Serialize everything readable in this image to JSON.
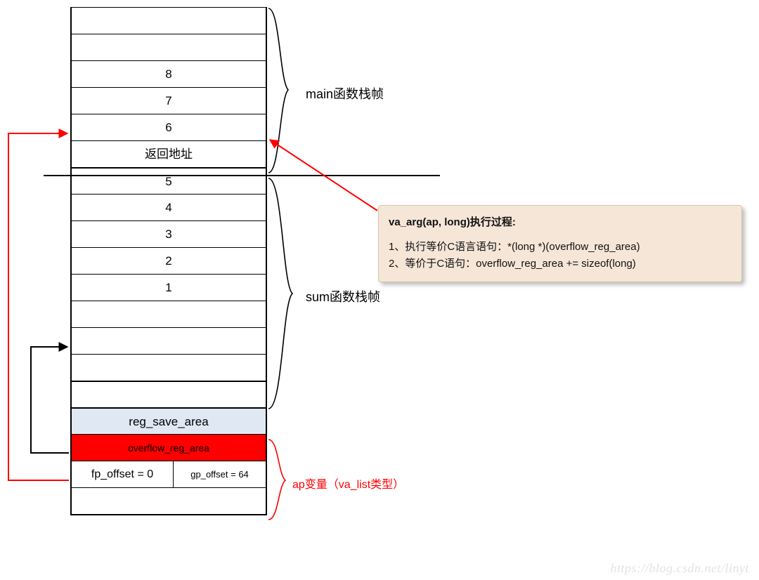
{
  "stack_cells": [
    {
      "kind": "blank",
      "text": ""
    },
    {
      "kind": "blank",
      "text": ""
    },
    {
      "kind": "value",
      "text": "8"
    },
    {
      "kind": "value",
      "text": "7"
    },
    {
      "kind": "value",
      "text": "6"
    },
    {
      "kind": "return_addr",
      "text": "返回地址"
    },
    {
      "kind": "value",
      "text": "5"
    },
    {
      "kind": "value",
      "text": "4"
    },
    {
      "kind": "value",
      "text": "3"
    },
    {
      "kind": "value",
      "text": "2"
    },
    {
      "kind": "value",
      "text": "1"
    },
    {
      "kind": "blank",
      "text": ""
    },
    {
      "kind": "blank",
      "text": ""
    },
    {
      "kind": "blank",
      "text": ""
    },
    {
      "kind": "blank",
      "text": ""
    },
    {
      "kind": "reg_save_area",
      "text": "reg_save_area"
    },
    {
      "kind": "overflow_reg_area",
      "text": "overflow_reg_area"
    },
    {
      "kind": "offsets",
      "fp": "fp_offset = 0",
      "gp": "gp_offset = 64"
    },
    {
      "kind": "blank",
      "text": ""
    }
  ],
  "labels": {
    "main_frame": "main函数栈帧",
    "sum_frame": "sum函数栈帧",
    "ap_var": "ap变量（va_list类型）"
  },
  "callout": {
    "title": "va_arg(ap, long)执行过程:",
    "line1": "1、执行等价C语言语句：*(long *)(overflow_reg_area)",
    "line2": "2、等价于C语句：overflow_reg_area += sizeof(long)"
  },
  "watermark": "https://blog.csdn.net/linyt",
  "colors": {
    "reg_save_bg": "#dfe8f3",
    "overflow_bg": "#ff0000",
    "callout_bg": "#f6e6d8"
  }
}
